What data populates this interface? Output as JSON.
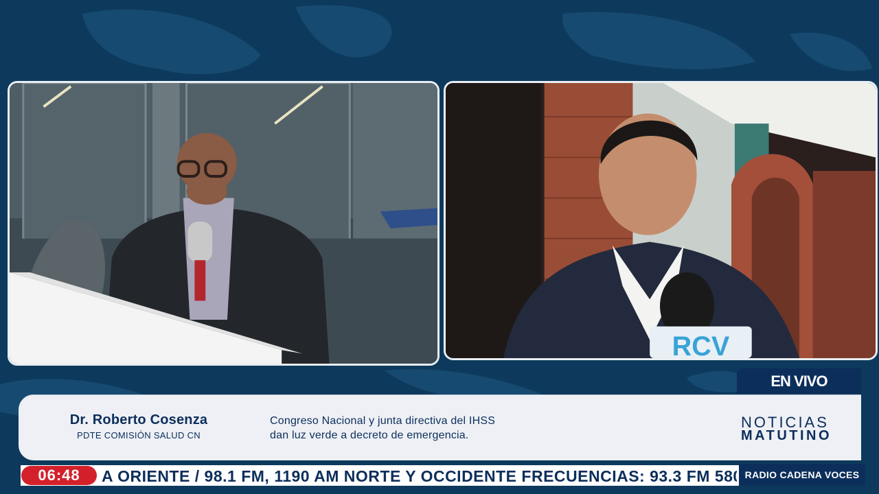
{
  "broadcast": {
    "live_label": "EN VIVO",
    "guest_name": "Dr. Roberto Cosenza",
    "guest_role": "PDTE COMISIÓN SALUD CN",
    "headline_line1": "Congreso Nacional y junta directiva del IHSS",
    "headline_line2": "dan luz verde a decreto de emergencia.",
    "brand_top": "NOTICIAS",
    "brand_bottom": "MATUTINO",
    "clock": "06:48",
    "ticker": "A ORIENTE / 98.1 FM, 1190 AM NORTE Y OCCIDENTE FRECUENCIAS: 93.3 FM 580",
    "station": "RADIO CADENA VOCES",
    "mic_logo": "RCV"
  },
  "colors": {
    "background": "#0d3a5c",
    "navy": "#0c2e5b",
    "clock_badge": "#d4202a",
    "lower_third": "#eef0f5"
  }
}
